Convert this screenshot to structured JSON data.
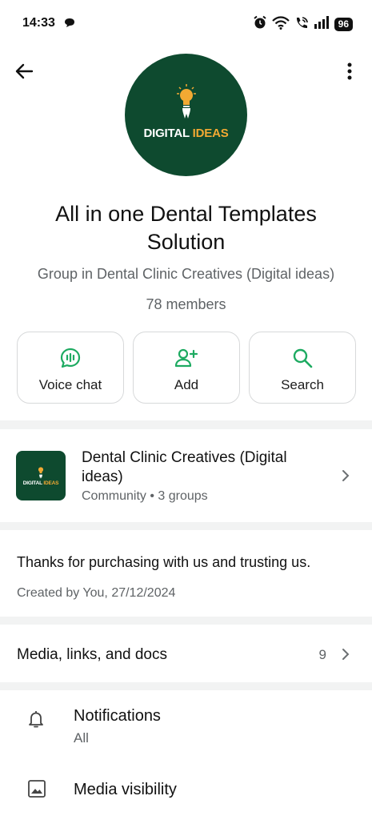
{
  "status_bar": {
    "time": "14:33",
    "battery": "96"
  },
  "header": {
    "logo_word1": "DIGITAL",
    "logo_word2": "IDEAS"
  },
  "group": {
    "name": "All in one Dental Templates Solution",
    "subtitle": "Group in Dental Clinic Creatives (Digital ideas)",
    "members": "78 members"
  },
  "actions": [
    {
      "label": "Voice chat",
      "icon": "voice-chat-icon"
    },
    {
      "label": "Add",
      "icon": "add-person-icon"
    },
    {
      "label": "Search",
      "icon": "search-icon"
    }
  ],
  "community": {
    "title": "Dental Clinic Creatives (Digital ideas)",
    "meta": "Community • 3 groups"
  },
  "description": {
    "text": "Thanks for purchasing with us and trusting us.",
    "created": "Created by You, 27/12/2024"
  },
  "media": {
    "label": "Media, links, and docs",
    "count": "9"
  },
  "settings": {
    "notifications_label": "Notifications",
    "notifications_value": "All",
    "media_visibility_label": "Media visibility"
  },
  "colors": {
    "accent": "#1daa61",
    "brand_green": "#0e4a2f",
    "brand_orange": "#f2a933"
  }
}
